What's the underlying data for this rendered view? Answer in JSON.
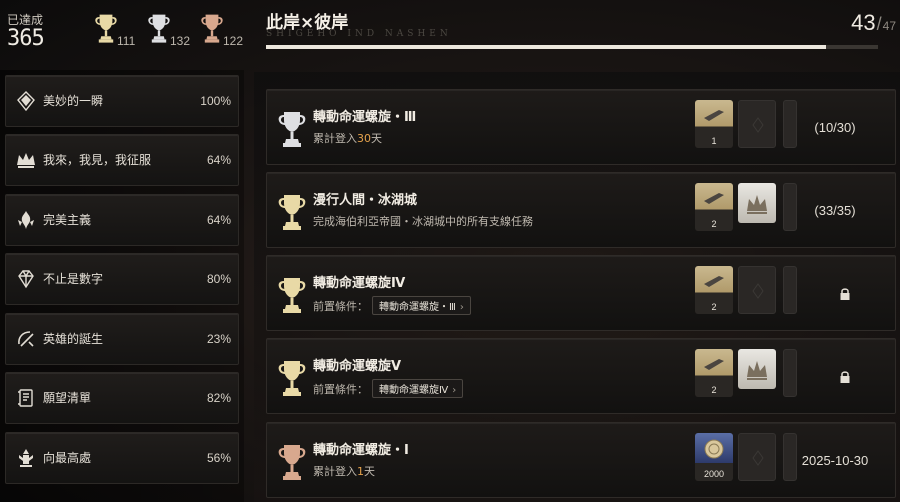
{
  "summary": {
    "label": "已達成",
    "total": "365",
    "gold": "111",
    "silver": "132",
    "bronze": "122"
  },
  "categories": [
    {
      "label": "美妙的一瞬",
      "percent": "100%",
      "icon": "diamond-crest-icon"
    },
    {
      "label": "我來，我見，我征服",
      "percent": "64%",
      "icon": "crown-icon"
    },
    {
      "label": "完美主義",
      "percent": "64%",
      "icon": "flame-crest-icon"
    },
    {
      "label": "不止是數字",
      "percent": "80%",
      "icon": "gem-icon"
    },
    {
      "label": "英雄的誕生",
      "percent": "23%",
      "icon": "sword-arc-icon"
    },
    {
      "label": "願望清單",
      "percent": "82%",
      "icon": "scroll-icon"
    },
    {
      "label": "向最高處",
      "percent": "56%",
      "icon": "tower-icon"
    }
  ],
  "header": {
    "title": "此岸×彼岸",
    "subtitle": "SHIGEHO IND NASHEN",
    "current": "43",
    "separator": "/",
    "total": "47",
    "progress": 0.915
  },
  "achievements": [
    {
      "title": "轉動命運螺旋・Ⅲ",
      "desc_prefix": "累計登入",
      "desc_highlight": "30",
      "desc_suffix": "天",
      "trophy": "silver",
      "reward1_qty": "1",
      "status": "(10/30)"
    },
    {
      "title": "漫行人間・冰湖城",
      "desc": "完成海伯利亞帝國・冰湖城中的所有支線任務",
      "trophy": "gold",
      "reward1_qty": "2",
      "status": "(33/35)"
    },
    {
      "title": "轉動命運螺旋Ⅳ",
      "prereq_label": "前置條件：",
      "prereq": "轉動命運螺旋・Ⅲ",
      "trophy": "gold",
      "reward1_qty": "2",
      "status": "locked"
    },
    {
      "title": "轉動命運螺旋Ⅴ",
      "prereq_label": "前置條件：",
      "prereq": "轉動命運螺旋Ⅳ",
      "trophy": "gold",
      "reward1_qty": "2",
      "status": "locked"
    },
    {
      "title": "轉動命運螺旋・Ⅰ",
      "desc_prefix": "累計登入",
      "desc_highlight": "1",
      "desc_suffix": "天",
      "trophy": "bronze",
      "reward1_qty": "2000",
      "status": "2025-10-30"
    }
  ],
  "colors": {
    "gold": "#e8d9a6",
    "silver": "#dedfe2",
    "bronze": "#d8a88e",
    "highlight": "#e5a24c"
  }
}
